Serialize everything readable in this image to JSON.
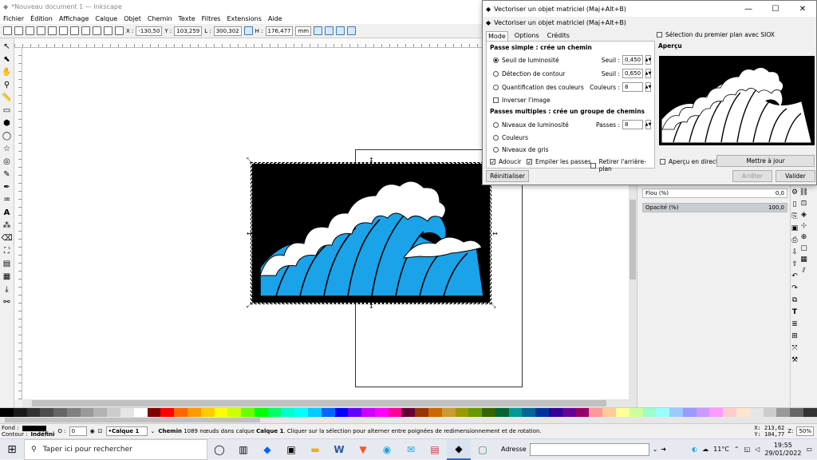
{
  "window": {
    "title": "*Nouveau document 1 — Inkscape"
  },
  "menu": [
    "Fichier",
    "Édition",
    "Affichage",
    "Calque",
    "Objet",
    "Chemin",
    "Texte",
    "Filtres",
    "Extensions",
    "Aide"
  ],
  "controls": {
    "x_label": "X :",
    "x_value": "-130,50",
    "y_label": "Y :",
    "y_value": "103,259",
    "w_label": "L :",
    "w_value": "300,302",
    "h_label": "H :",
    "h_value": "176,477",
    "unit": "mm"
  },
  "dialog": {
    "window_title": "Vectoriser un objet matriciel (Maj+Alt+B)",
    "subtitle": "Vectoriser un objet matriciel (Maj+Alt+B)",
    "win_buttons": [
      "—",
      "☐",
      "✕"
    ],
    "tabs": [
      "Mode",
      "Options",
      "Crédits"
    ],
    "single_pass_title": "Passe simple : crée un chemin",
    "brightness_label": "Seuil de luminosité",
    "threshold_label": "Seuil :",
    "threshold_value": "0,450",
    "edge_label": "Détection de contour",
    "edge_threshold_label": "Seuil :",
    "edge_threshold_value": "0,650",
    "color_quant_label": "Quantification des couleurs",
    "colors_label": "Couleurs :",
    "colors_value": "8",
    "invert_label": "Inverser l'image",
    "multi_pass_title": "Passes multiples : crée un groupe de chemins",
    "brightness_steps_label": "Niveaux de luminosité",
    "passes_label": "Passes :",
    "passes_value": "8",
    "colors_option_label": "Couleurs",
    "grays_label": "Niveaux de gris",
    "smooth_label": "Adoucir",
    "stack_label": "Empiler les passes",
    "remove_bg_label": "Retirer l'arrière-plan",
    "reset_label": "Réinitialiser",
    "siox_label": "Sélection du premier plan avec SIOX",
    "preview_title": "Aperçu",
    "live_preview_label": "Aperçu en direct",
    "update_label": "Mettre à jour",
    "stop_label": "Arrêter",
    "ok_label": "Valider"
  },
  "fill_stroke": {
    "blur_label": "Flou (%)",
    "blur_value": "0,0",
    "opacity_label": "Opacité (%)",
    "opacity_value": "100,0"
  },
  "statusbar": {
    "fill_label": "Fond :",
    "stroke_label": "Contour :",
    "stroke_value": "Indéfini",
    "o_label": "O :",
    "o_value": "0",
    "layer_value": "•Calque 1",
    "message_bold1": "Chemin",
    "message_mid": " 1089 nœuds dans calque ",
    "message_bold2": "Calque 1",
    "message_end": ". Cliquer sur la sélection pour alterner entre poignées de redimensionnement et de rotation.",
    "coord_x_label": "X:",
    "coord_x": "213,62",
    "coord_y_label": "Y:",
    "coord_y": "104,77",
    "zoom_label": "Z:",
    "zoom": "50%"
  },
  "taskbar": {
    "search_placeholder": "Taper ici pour rechercher",
    "address_label": "Adresse",
    "temperature": "11°C",
    "time": "19:55",
    "date": "29/01/2022"
  },
  "palette_colors": [
    "#000000",
    "#1a1a1a",
    "#333333",
    "#4d4d4d",
    "#666666",
    "#808080",
    "#999999",
    "#b3b3b3",
    "#cccccc",
    "#e6e6e6",
    "#ffffff",
    "#800000",
    "#ff0000",
    "#ff6600",
    "#ff9900",
    "#ffcc00",
    "#ffff00",
    "#ccff00",
    "#66ff00",
    "#00ff00",
    "#00ff66",
    "#00ffcc",
    "#00ffff",
    "#00ccff",
    "#0066ff",
    "#0000ff",
    "#6600ff",
    "#cc00ff",
    "#ff00ff",
    "#ff0099",
    "#660033",
    "#993300",
    "#cc6600",
    "#cc9933",
    "#999900",
    "#669900",
    "#336600",
    "#006633",
    "#009999",
    "#006699",
    "#003399",
    "#330099",
    "#660099",
    "#990066",
    "#ff9999",
    "#ffcc99",
    "#ffff99",
    "#ccff99",
    "#99ffcc",
    "#99ffff",
    "#99ccff",
    "#9999ff",
    "#cc99ff",
    "#ff99ff",
    "#ffcccc",
    "#ffe5cc",
    "#e6e6e6",
    "#cccccc",
    "#999999",
    "#666666",
    "#333333"
  ],
  "art": {
    "sky": "#000000",
    "wave": "#1aa3e8",
    "foam": "#ffffff"
  }
}
